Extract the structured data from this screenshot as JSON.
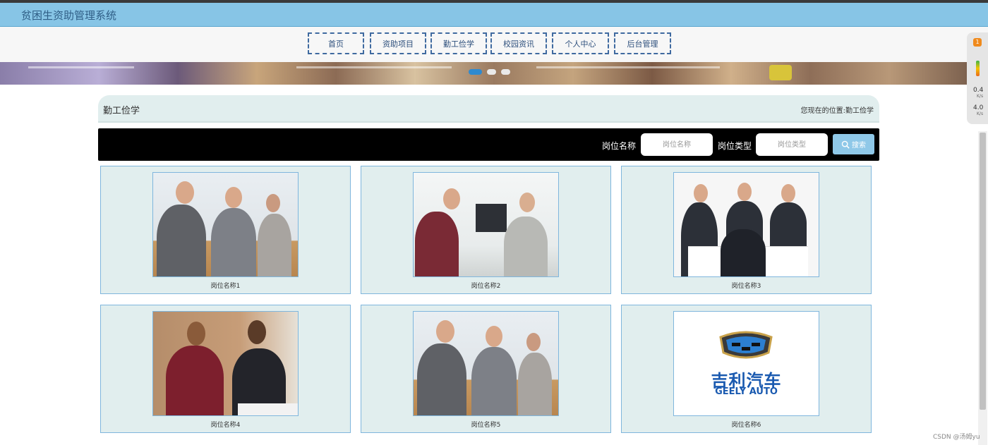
{
  "app": {
    "title": "贫困生资助管理系统"
  },
  "nav": [
    {
      "label": "首页"
    },
    {
      "label": "资助项目"
    },
    {
      "label": "勤工俭学"
    },
    {
      "label": "校园资讯"
    },
    {
      "label": "个人中心"
    },
    {
      "label": "后台管理"
    }
  ],
  "page": {
    "title": "勤工俭学",
    "location_label": "您现在的位置:",
    "location_value": "勤工俭学"
  },
  "search": {
    "name_label": "岗位名称",
    "name_placeholder": "岗位名称",
    "type_label": "岗位类型",
    "type_placeholder": "岗位类型",
    "button_label": "搜索",
    "button_icon": "search-icon"
  },
  "jobs": [
    {
      "name": "岗位名称1",
      "image": "office-meeting-photo"
    },
    {
      "name": "岗位名称2",
      "image": "interview-desk-photo"
    },
    {
      "name": "岗位名称3",
      "image": "group-interview-photo"
    },
    {
      "name": "岗位名称4",
      "image": "handshake-photo"
    },
    {
      "name": "岗位名称5",
      "image": "office-meeting-photo"
    },
    {
      "name": "岗位名称6",
      "image": "geely-auto-logo",
      "logo_text": "吉利汽车",
      "logo_subtext": "GEELY AUTO"
    }
  ],
  "side_widget": {
    "badge": "1",
    "up_value": "0.4",
    "up_unit": "K/s",
    "down_value": "4.0",
    "down_unit": "K/s"
  },
  "carousel": {
    "slides": 3,
    "active": 1
  },
  "watermark": "CSDN @汤姆yu",
  "colors": {
    "header": "#87c5e6",
    "accent": "#2e8ad0",
    "card_bg": "#e1eeee",
    "button": "#8fc8e8"
  }
}
